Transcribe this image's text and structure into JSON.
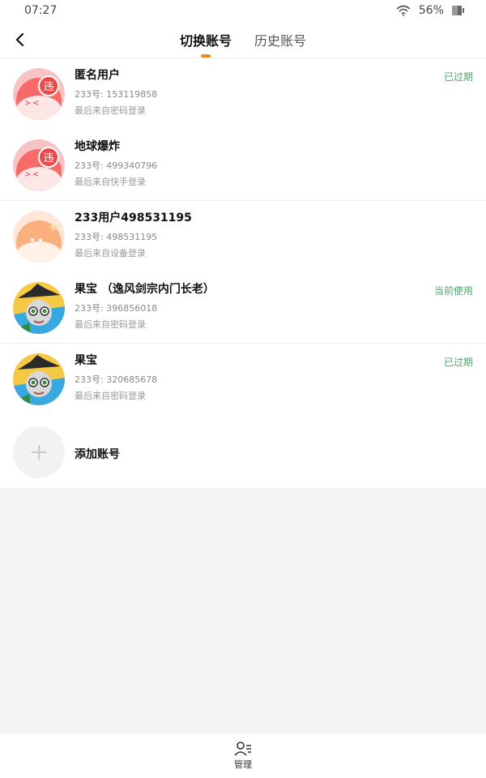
{
  "status_bar": {
    "time": "07:27",
    "battery": "56%",
    "battery_level": 0.56
  },
  "header": {
    "tabs": [
      {
        "label": "切换账号",
        "active": true
      },
      {
        "label": "历史账号",
        "active": false
      }
    ]
  },
  "accounts": [
    {
      "name": "匿名用户",
      "uid": "233号: 153119858",
      "login": "最后来自密码登录",
      "status": "已过期",
      "avatar_badge": "违"
    },
    {
      "name": "地球爆炸",
      "uid": "233号: 499340796",
      "login": "最后来自快手登录",
      "status": "",
      "avatar_badge": "违"
    },
    {
      "name": "233用户498531195",
      "uid": "233号: 498531195",
      "login": "最后来自设备登录",
      "status": ""
    },
    {
      "name": "果宝 （逸风剑宗内门长老）",
      "uid": "233号: 396856018",
      "login": "最后来自密码登录",
      "status": "当前使用"
    },
    {
      "name": "果宝",
      "uid": "233号: 320685678",
      "login": "最后来自密码登录",
      "status": "已过期"
    }
  ],
  "add_account": {
    "label": "添加账号"
  },
  "bottom": {
    "manage_label": "管理"
  },
  "colors": {
    "accent": "#f08a24",
    "status_green": "#4fa66b"
  }
}
